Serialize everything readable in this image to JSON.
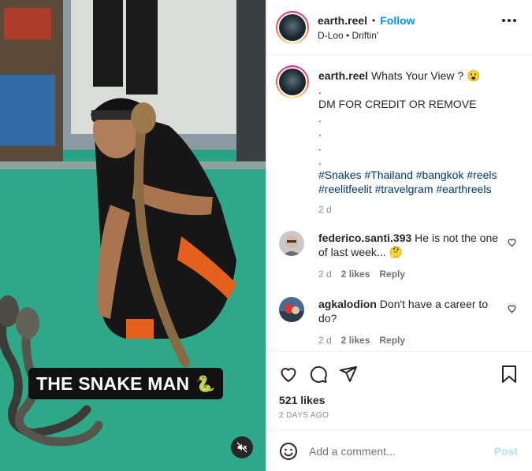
{
  "colors": {
    "accent": "#0095f6",
    "hashtag": "#00376b",
    "muted": "#8e8e8e",
    "post_disabled": "#b2dffc"
  },
  "media": {
    "overlay_text": "THE SNAKE MAN",
    "overlay_emoji": "🐍",
    "mute_icon": "speaker-muted-icon"
  },
  "header": {
    "username": "earth.reel",
    "separator": "•",
    "follow_label": "Follow",
    "audio": "D-Loo • Driftin'",
    "more_icon": "more-horizontal-icon"
  },
  "caption": {
    "username": "earth.reel",
    "first_line": "Whats Your View ? 😮",
    "dot1": ".",
    "dm_line": "DM FOR CREDIT OR REMOVE",
    "dot2": ".",
    "dot3": ".",
    "dot4": ".",
    "dot5": ".",
    "hashtags_line1": "#Snakes #Thailand #bangkok #reels",
    "hashtags_line2": "#reelitfeelit #travelgram #earthreels",
    "time": "2 d"
  },
  "comments": [
    {
      "username": "federico.santi.393",
      "text": "He is not the one of last week... 🤔",
      "time": "2 d",
      "likes": "2 likes",
      "reply": "Reply"
    },
    {
      "username": "agkalodion",
      "text": "Don't have a career to do?",
      "time": "2 d",
      "likes": "2 likes",
      "reply": "Reply"
    }
  ],
  "actions": {
    "like_icon": "heart-icon",
    "comment_icon": "comment-bubble-icon",
    "share_icon": "paper-plane-icon",
    "save_icon": "bookmark-icon",
    "likes_count": "521 likes",
    "posted_ago": "2 DAYS AGO"
  },
  "add_comment": {
    "emoji_icon": "emoji-smiley-icon",
    "placeholder": "Add a comment...",
    "post_label": "Post"
  }
}
